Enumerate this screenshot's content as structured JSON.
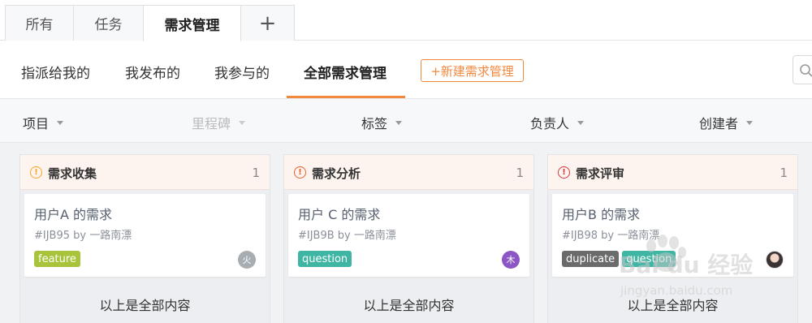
{
  "top_tabs": [
    {
      "label": "所有"
    },
    {
      "label": "任务"
    },
    {
      "label": "需求管理"
    },
    {
      "label": "+"
    }
  ],
  "subnav": {
    "items": [
      "指派给我的",
      "我发布的",
      "我参与的",
      "全部需求管理"
    ],
    "active": "全部需求管理",
    "new_button": "+新建需求管理"
  },
  "filters": [
    "项目",
    "里程碑",
    "标签",
    "负责人",
    "创建者"
  ],
  "columns": [
    {
      "icon": "!",
      "icon_color": "#f5a623",
      "title": "需求收集",
      "count": "1",
      "card": {
        "title": "用户A 的需求",
        "meta": "#IJB95   by 一路南漂",
        "tags": [
          {
            "label": "feature",
            "color": "#a7c43a"
          }
        ],
        "avatar": "火",
        "avatar_color": "#a8adb3"
      },
      "footer": "以上是全部内容"
    },
    {
      "icon": "!",
      "icon_color": "#e8612c",
      "title": "需求分析",
      "count": "1",
      "card": {
        "title": "用户 C 的需求",
        "meta": "#IJB9B   by 一路南漂",
        "tags": [
          {
            "label": "question",
            "color": "#3fb5a3"
          }
        ],
        "avatar": "木",
        "avatar_color": "#8c56c4"
      },
      "footer": "以上是全部内容"
    },
    {
      "icon": "!",
      "icon_color": "#d9363e",
      "title": "需求评审",
      "count": "1",
      "card": {
        "title": "用户B 的需求",
        "meta": "#IJB98   by 一路南漂",
        "tags": [
          {
            "label": "duplicate",
            "color": "#6b6b6b"
          },
          {
            "label": "question",
            "color": "#3fb5a3"
          }
        ],
        "avatar": "",
        "avatar_color": ""
      },
      "footer": "以上是全部内容"
    }
  ],
  "watermark": {
    "brand": "Bai du 经验",
    "url": "jingyan.baidu.com"
  }
}
